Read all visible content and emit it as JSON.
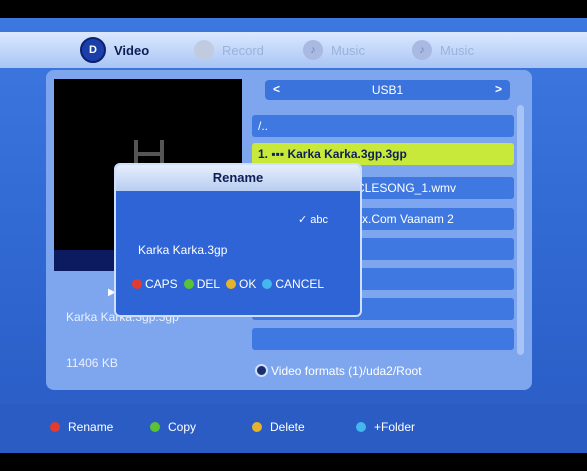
{
  "tabs": [
    {
      "label": "Video",
      "icon": "D"
    },
    {
      "label": "Record"
    },
    {
      "label": "Music"
    },
    {
      "label": "Music"
    }
  ],
  "preview": {
    "filename": "Karka Karka.3gp.3gp",
    "size": "11406 KB"
  },
  "file_list": {
    "device": "USB1",
    "prev_label": "<",
    "next_label": ">",
    "rows": [
      {
        "text": "/.."
      },
      {
        "text": "1.  ▪▪▪ Karka Karka.3gp.3gp"
      },
      {
        "text": "CLESONG_1.wmv"
      },
      {
        "text": "sx.Com Vaanam 2"
      }
    ],
    "path": "Video formats (1)/uda2/Root"
  },
  "dialog": {
    "title": "Rename",
    "input_mode": "abc",
    "value": "Karka Karka.3gp",
    "buttons": [
      {
        "label": "CAPS",
        "color": "#e23b2f"
      },
      {
        "label": "DEL",
        "color": "#59c235"
      },
      {
        "label": "OK",
        "color": "#e6b32c"
      },
      {
        "label": "CANCEL",
        "color": "#42b8ee"
      }
    ]
  },
  "bottom_bar": [
    {
      "label": "Rename",
      "color": "#e23b2f"
    },
    {
      "label": "Copy",
      "color": "#59c235"
    },
    {
      "label": "Delete",
      "color": "#e6b32c"
    },
    {
      "label": "+Folder",
      "color": "#42b8ee"
    }
  ]
}
